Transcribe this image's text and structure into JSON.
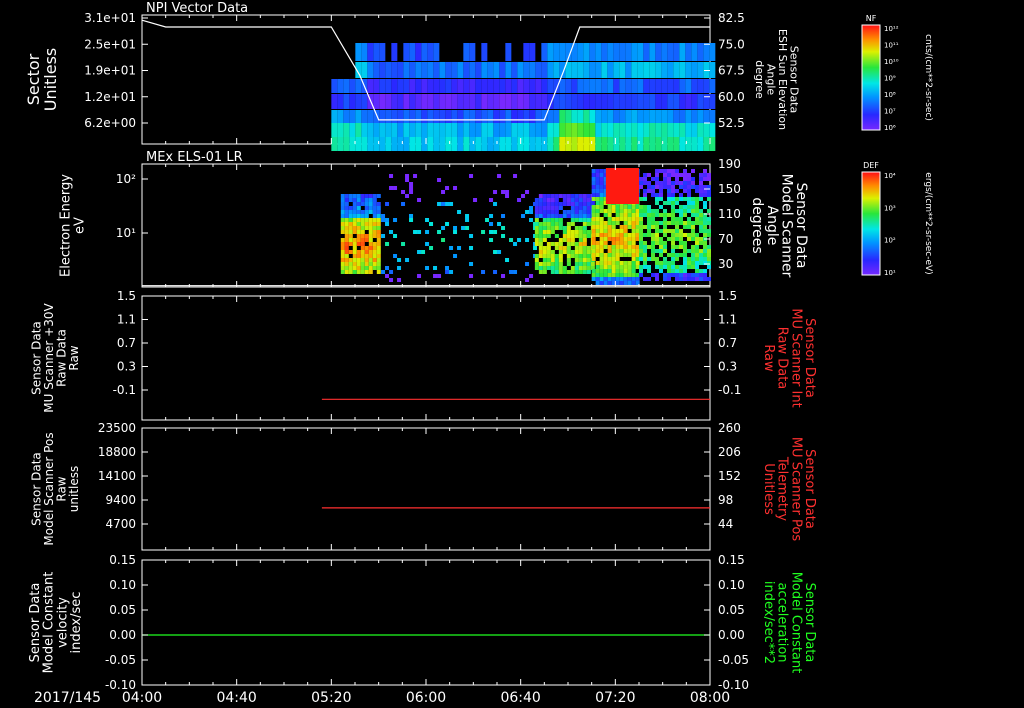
{
  "date_label": "2017/145",
  "time_ticks": [
    "04:00",
    "04:40",
    "05:20",
    "06:00",
    "06:40",
    "07:20",
    "08:00"
  ],
  "colors": {
    "white": "#ffffff",
    "red": "#ff3030",
    "green": "#20ff20",
    "bg": "#000000"
  },
  "chart_data": [
    {
      "type": "heatmap",
      "title": "NPI Vector Data",
      "ylabel": "Sector\nUnitless",
      "ylabel_right": "Sensor Data\nESH Sun Elevation\nAngle\ndegree",
      "yticks_left": [
        "3.1e+01",
        "2.5e+01",
        "1.9e+01",
        "1.2e+01",
        "6.2e+00"
      ],
      "yticks_right": [
        "82.5",
        "75.0",
        "67.5",
        "60.0",
        "52.5"
      ],
      "yrange_right": [
        45,
        82.5
      ],
      "overlay_line": {
        "name": "ESH Sun Elevation Angle",
        "x": [
          "04:00",
          "04:10",
          "05:20",
          "05:32",
          "05:40",
          "06:50",
          "06:58",
          "07:05",
          "08:00"
        ],
        "y": [
          81,
          79,
          79,
          65,
          52,
          52,
          66,
          79,
          79
        ]
      },
      "colorbar": {
        "label": "NF",
        "unit": "cnts/(cm**2-sr-sec)",
        "ticks": [
          "10¹²",
          "10¹¹",
          "10¹⁰",
          "10⁹",
          "10⁸",
          "10⁷",
          "10⁶"
        ]
      }
    },
    {
      "type": "heatmap",
      "title": "MEx ELS-01 LR",
      "ylabel": "Electron Energy\neV",
      "ylabel_right": "Sensor Data\nModel Scanner\nAngle\ndegrees",
      "yticks_left": [
        "10²",
        "10¹"
      ],
      "yticks_right": [
        "190",
        "150",
        "110",
        "70",
        "30"
      ],
      "yrange_right": [
        0,
        190
      ],
      "overlay_line": {
        "name": "Model Scanner Angle",
        "x": [
          "04:00",
          "08:00"
        ],
        "y": [
          2,
          2
        ]
      },
      "colorbar": {
        "label": "DEF",
        "unit": "ergs/(cm**2-sr-sec-eV)",
        "ticks": [
          "10⁴",
          "10³",
          "10²",
          "10¹"
        ]
      }
    },
    {
      "type": "line",
      "ylabel": "Sensor Data\nMU Scanner +30V\nRaw Data\nRaw",
      "ylabel_right": "Sensor Data\nMU Scanner Int\nRaw Data\nRaw",
      "yticks_left": [
        "1.5",
        "1.1",
        "0.7",
        "0.3",
        "-0.1"
      ],
      "yticks_right": [
        "1.5",
        "1.1",
        "0.7",
        "0.3",
        "-0.1"
      ],
      "ylim": [
        -0.3,
        1.5
      ],
      "series": [
        {
          "color": "red",
          "x": [
            "05:16",
            "08:00"
          ],
          "y": [
            0.0,
            0.0
          ]
        }
      ]
    },
    {
      "type": "line",
      "ylabel": "Sensor Data\nModel Scanner Pos\nRaw\nunitless",
      "ylabel_right": "Sensor Data\nMU Scanner Pos\nTelemetry\nUnitless",
      "yticks_left": [
        "23500",
        "18800",
        "14100",
        "9400",
        "4700"
      ],
      "yticks_right": [
        "260",
        "206",
        "152",
        "98",
        "44"
      ],
      "ylim": [
        0,
        23500
      ],
      "series": [
        {
          "color": "red",
          "x": [
            "05:16",
            "08:00"
          ],
          "y": [
            8100,
            8100
          ]
        }
      ]
    },
    {
      "type": "line",
      "ylabel": "Sensor Data\nModel Constant\nvelocity\nindex/sec",
      "ylabel_right": "Sensor Data\nModel Constant\nacceleration\nindex/sec**2",
      "yticks_left": [
        "0.15",
        "0.10",
        "0.05",
        "0.00",
        "-0.05",
        "-0.10"
      ],
      "yticks_right": [
        "0.15",
        "0.10",
        "0.05",
        "0.00",
        "-0.05",
        "-0.10"
      ],
      "ylim": [
        -0.1,
        0.15
      ],
      "series": [
        {
          "color": "green",
          "x": [
            "04:00",
            "08:00"
          ],
          "y": [
            0.0,
            0.0
          ]
        }
      ]
    }
  ]
}
